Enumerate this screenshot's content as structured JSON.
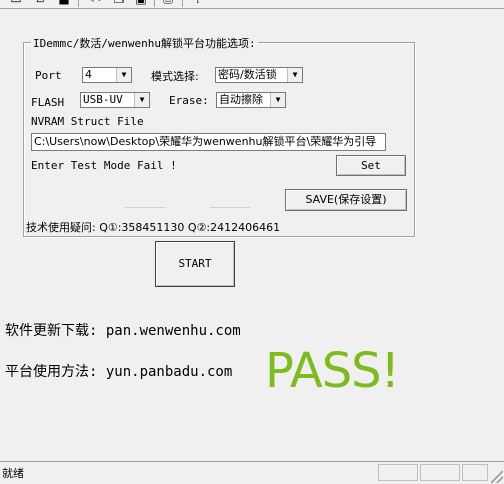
{
  "group": {
    "title": "IDemmc/数活/wenwenhu解锁平台功能选项:"
  },
  "port": {
    "label": "Port",
    "value": "4"
  },
  "mode": {
    "label": "模式选择:",
    "value": "密码/数活锁"
  },
  "flash": {
    "label": "FLASH",
    "value": "USB-UV"
  },
  "erase": {
    "label": "Erase:",
    "value": "自动擦除"
  },
  "nvram": {
    "label": "NVRAM Struct File",
    "path": "C:\\Users\\now\\Desktop\\荣耀华为wenwenhu解锁平台\\荣耀华为引导"
  },
  "status_message": "Enter Test Mode Fail !",
  "buttons": {
    "set": "Set",
    "save": "SAVE(保存设置)",
    "start": "START"
  },
  "support": "技术使用疑问: Q①:358451130  Q②:2412406461",
  "footer": {
    "download": "软件更新下载: pan.wenwenhu.com",
    "usage": "平台使用方法: yun.panbadu.com"
  },
  "result": {
    "text": "PASS!",
    "color": "#7dbb1f"
  },
  "statusbar": {
    "text": "就绪"
  },
  "toolbar": {
    "icons": [
      "new-icon",
      "open-icon",
      "save-icon",
      "cut-icon",
      "copy-icon",
      "paste-icon",
      "print-icon",
      "help-icon"
    ]
  }
}
